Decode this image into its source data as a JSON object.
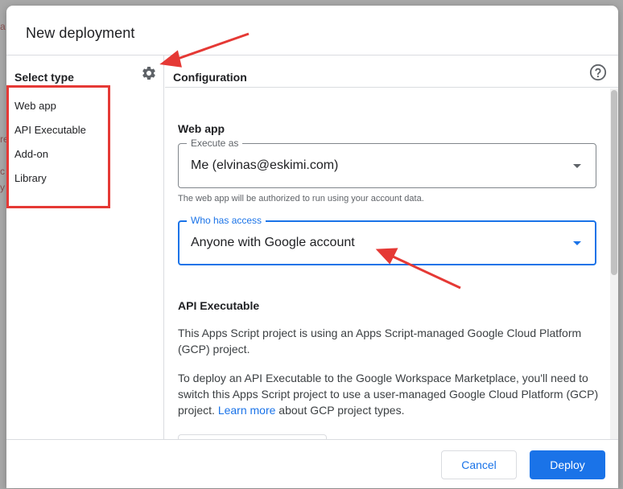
{
  "dialog": {
    "title": "New deployment"
  },
  "left_pane": {
    "title": "Select type",
    "settings_icon": "gear-icon",
    "types": [
      "Web app",
      "API Executable",
      "Add-on",
      "Library"
    ]
  },
  "config": {
    "title": "Configuration",
    "help_icon": "help-circle-icon",
    "web_app": {
      "heading": "Web app",
      "execute_as": {
        "label": "Execute as",
        "value": "Me (elvinas@eskimi.com)"
      },
      "hint": "The web app will be authorized to run using your account data.",
      "who_has_access": {
        "label": "Who has access",
        "value": "Anyone with Google account"
      }
    },
    "api_executable": {
      "heading": "API Executable",
      "para1": "This Apps Script project is using an Apps Script-managed Google Cloud Platform (GCP) project.",
      "para2_before": "To deploy an API Executable to the Google Workspace Marketplace, you'll need to switch this Apps Script project to use a user-managed Google Cloud Platform (GCP) project. ",
      "learn_more": "Learn more",
      "para2_after": " about GCP project types."
    }
  },
  "footer": {
    "cancel_label": "Cancel",
    "deploy_label": "Deploy"
  },
  "colors": {
    "accent": "#1a73e8",
    "annotation": "#e53935"
  }
}
